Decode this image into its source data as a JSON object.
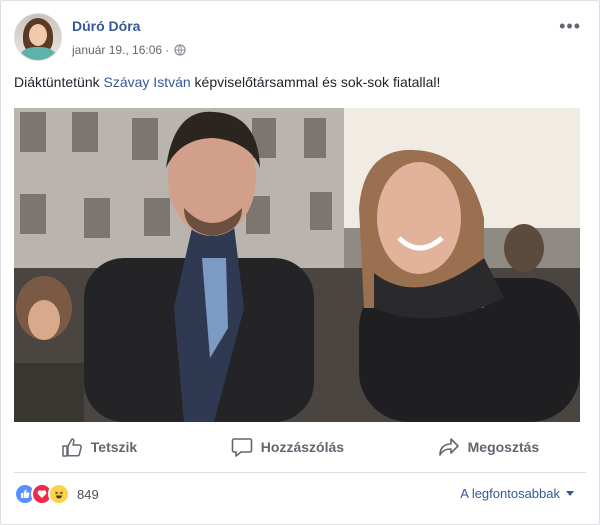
{
  "post": {
    "author": "Dúró Dóra",
    "timestamp": "január 19., 16:06",
    "separator": "·",
    "text_before": "Diáktüntetünk ",
    "tagged": "Szávay István",
    "text_after": " képviselőtársammal és sok-sok fiatallal!"
  },
  "actions": {
    "like": "Tetszik",
    "comment": "Hozzászólás",
    "share": "Megosztás"
  },
  "footer": {
    "reaction_count": "849",
    "sort_label": "A legfontosabbak"
  },
  "colors": {
    "link": "#365899",
    "like": "#5890ff",
    "love": "#f0284a",
    "haha": "#fbd249"
  },
  "icons": [
    "more-icon",
    "globe-icon",
    "like-icon",
    "comment-icon",
    "share-icon",
    "caret-down-icon"
  ]
}
